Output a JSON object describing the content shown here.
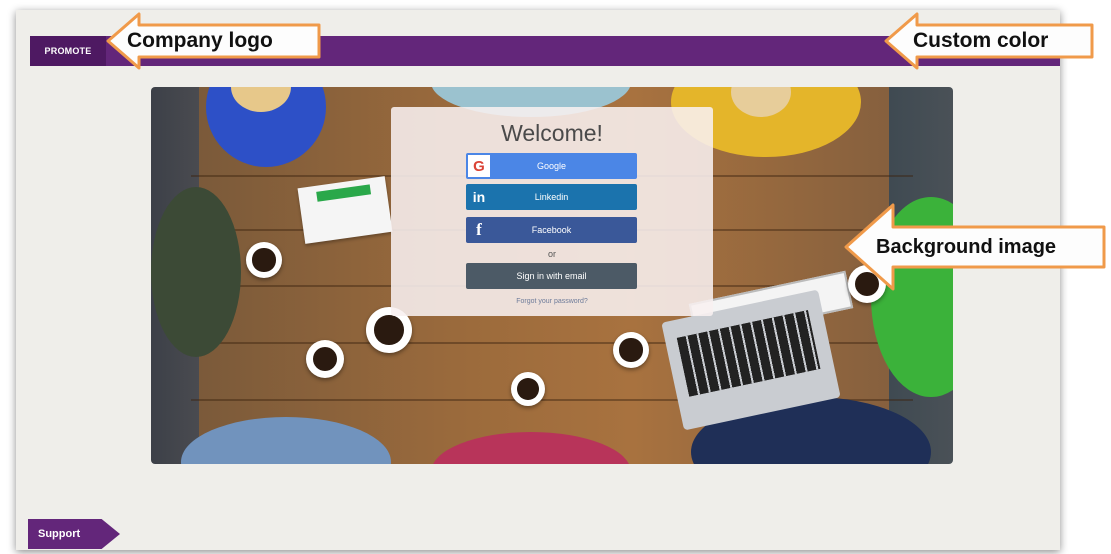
{
  "header": {
    "logo_text": "PROMOTE"
  },
  "login_card": {
    "title": "Welcome!",
    "buttons": {
      "google": {
        "label": "Google",
        "icon": "google-icon"
      },
      "linkedin": {
        "label": "Linkedin",
        "icon_text": "in"
      },
      "facebook": {
        "label": "Facebook",
        "icon_text": "f"
      },
      "email": {
        "label": "Sign in with email"
      }
    },
    "or_text": "or",
    "forgot_link": "Forgot your password?"
  },
  "footer": {
    "support_label": "Support"
  },
  "annotations": {
    "logo": "Company logo",
    "color": "Custom color",
    "background": "Background image"
  },
  "colors": {
    "brand": "#63267a",
    "google": "#4b86e6",
    "linkedin": "#1b73ad",
    "facebook": "#3a5899",
    "email": "#4c5a66",
    "callout": "#f09a4a"
  }
}
